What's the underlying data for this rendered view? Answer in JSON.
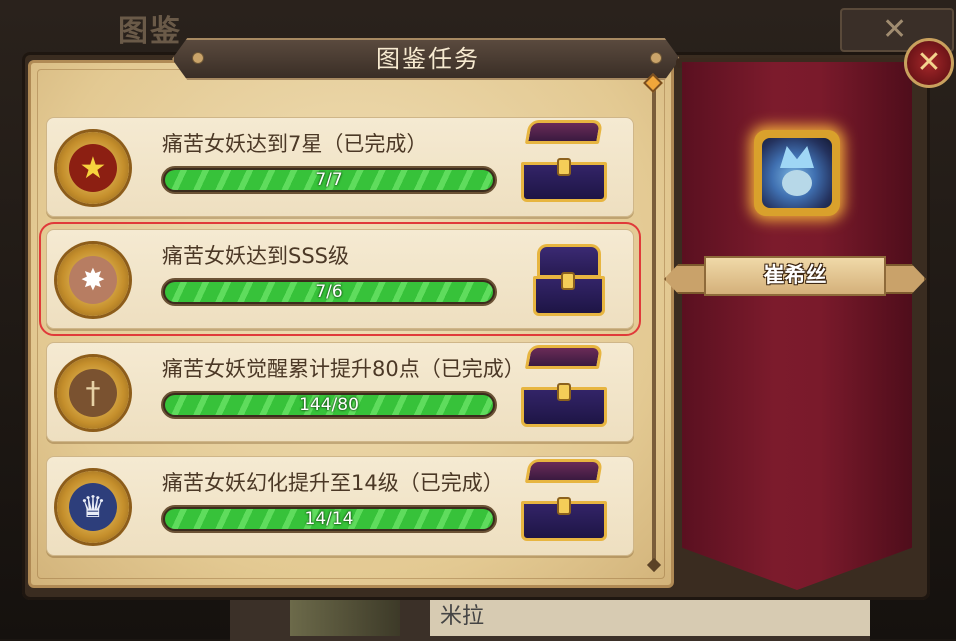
{
  "background": {
    "title": "图鉴",
    "bottom_label": "米拉"
  },
  "panel": {
    "title": "图鉴任务"
  },
  "tasks": [
    {
      "text": "痛苦女妖达到7星（已完成）",
      "progress": "7/7",
      "fill": 1.0,
      "medal": "star-medal-icon",
      "chest": "open"
    },
    {
      "text": "痛苦女妖达到SSS级",
      "progress": "7/6",
      "fill": 1.0,
      "medal": "badge-medal-icon",
      "chest": "closed",
      "selected": true
    },
    {
      "text": "痛苦女妖觉醒累计提升80点（已完成）",
      "progress": "144/80",
      "fill": 1.0,
      "medal": "sword-medal-icon",
      "chest": "open"
    },
    {
      "text": "痛苦女妖幻化提升至14级（已完成）",
      "progress": "14/14",
      "fill": 1.0,
      "medal": "trophy-medal-icon",
      "chest": "open"
    }
  ],
  "hero": {
    "name": "崔希丝"
  },
  "icons": {
    "close": "close-icon",
    "star": "★",
    "badge": "✸",
    "sword": "†",
    "trophy": "♛",
    "x": "✕"
  },
  "colors": {
    "selection_outline": "#e03a3a",
    "progress_green": "#37c23a",
    "banner": "#7c1b2c"
  }
}
